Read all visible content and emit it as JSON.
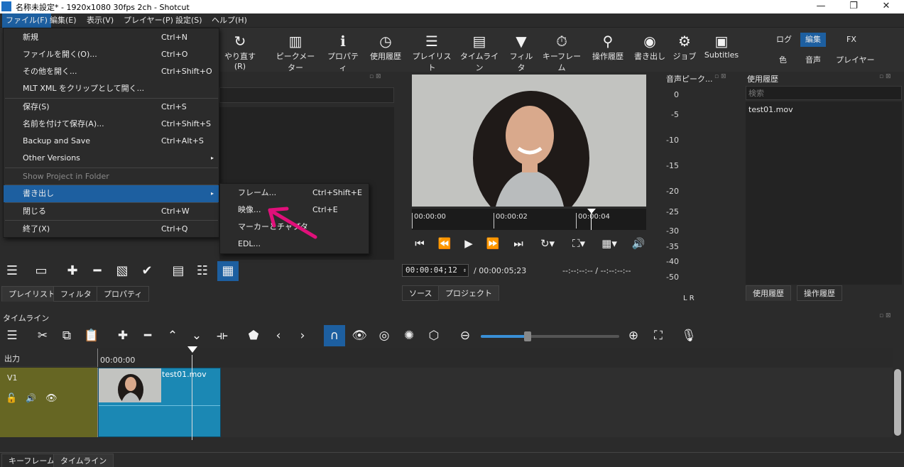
{
  "titlebar": {
    "title": "名称未設定* - 1920x1080 30fps 2ch - Shotcut",
    "minimize": "—",
    "maximize": "❐",
    "close": "✕"
  },
  "menubar": {
    "items": [
      "ファイル(F)",
      "編集(E)",
      "表示(V)",
      "プレイヤー(P)",
      "設定(S)",
      "ヘルプ(H)"
    ]
  },
  "toolbar": {
    "buttons": [
      "やり直す(R)",
      "ピークメーター",
      "プロパティ",
      "使用履歴",
      "プレイリスト",
      "タイムライン",
      "フィルタ",
      "キーフレーム",
      "操作履歴",
      "書き出し",
      "ジョブ",
      "Subtitles"
    ],
    "layouts_top": [
      "ログ",
      "編集",
      "FX"
    ],
    "layouts_bottom": [
      "色",
      "音声",
      "プレイヤー"
    ]
  },
  "file_menu": {
    "items": [
      {
        "label": "新規",
        "shortcut": "Ctrl+N"
      },
      {
        "label": "ファイルを開く(O)...",
        "shortcut": "Ctrl+O"
      },
      {
        "label": "その他を開く...",
        "shortcut": "Ctrl+Shift+O"
      },
      {
        "label": "MLT XML をクリップとして開く...",
        "shortcut": ""
      },
      {
        "label": "保存(S)",
        "shortcut": "Ctrl+S"
      },
      {
        "label": "名前を付けて保存(A)...",
        "shortcut": "Ctrl+Shift+S"
      },
      {
        "label": "Backup and Save",
        "shortcut": "Ctrl+Alt+S"
      },
      {
        "label": "Other Versions",
        "shortcut": "▸"
      },
      {
        "label": "Show Project in Folder",
        "shortcut": ""
      },
      {
        "label": "書き出し",
        "shortcut": "▸"
      },
      {
        "label": "閉じる",
        "shortcut": "Ctrl+W"
      },
      {
        "label": "終了(X)",
        "shortcut": "Ctrl+Q"
      }
    ]
  },
  "export_submenu": {
    "items": [
      {
        "label": "フレーム...",
        "shortcut": "Ctrl+Shift+E"
      },
      {
        "label": "映像...",
        "shortcut": "Ctrl+E"
      },
      {
        "label": "マーカーとチャプタ",
        "shortcut": ""
      },
      {
        "label": "EDL...",
        "shortcut": ""
      }
    ]
  },
  "playlist_panel": {
    "tabs": [
      "プレイリスト",
      "フィルタ",
      "プロパティ"
    ]
  },
  "player": {
    "ruler_labels": [
      "00:00:00",
      "00:00:02",
      "00:00:04"
    ],
    "timecode": "00:00:04;12",
    "duration": "/ 00:00:05;23",
    "in_out": "--:--:--:-- / --:--:--:--",
    "tabs": [
      "ソース",
      "プロジェクト"
    ]
  },
  "audio_meter": {
    "title": "音声ピーク...",
    "scale": [
      "0",
      "-5",
      "-10",
      "-15",
      "-20",
      "-25",
      "-30",
      "-35",
      "-40",
      "-50"
    ],
    "channels": "L  R"
  },
  "recent_panel": {
    "title": "使用履歴",
    "search_placeholder": "検索",
    "items": [
      "test01.mov"
    ],
    "tabs": [
      "使用履歴",
      "操作履歴"
    ]
  },
  "timeline": {
    "title": "タイムライン",
    "output_label": "出力",
    "ruler_start": "00:00:00",
    "track_name": "V1",
    "clip_name": "test01.mov"
  },
  "bottom_tabs": [
    "キーフレーム",
    "タイムライン"
  ],
  "colors": {
    "accent": "#1d5fa0",
    "arrow": "#e0107a",
    "track_header": "#666623",
    "clip": "#1b88b4"
  }
}
